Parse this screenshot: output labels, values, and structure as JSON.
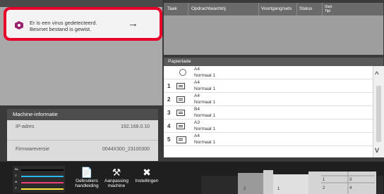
{
  "notification": {
    "line1": "Er is een virus gedetecteerd.",
    "line2": "Besmet bestand is gewist.",
    "arrow": "→",
    "icon": "virus-warning-icon",
    "accent_color": "#e8002a"
  },
  "machine_info": {
    "title": "Machine-informatie",
    "rows": [
      {
        "label": "IP-adres",
        "value": "192.168.0.10"
      },
      {
        "label": "Firmwareversie",
        "value": "0044X300_23100300"
      }
    ]
  },
  "job_queue": {
    "columns": [
      "Taak",
      "Opdrachtwachtrij",
      "Voortgang/sets",
      "Status",
      "Start Tijd"
    ]
  },
  "paper_trays": {
    "title": "Papierlade",
    "rows": [
      {
        "num": "",
        "size": "A4",
        "type": "Normaal 1",
        "icon": "bypass-tray-icon"
      },
      {
        "num": "1",
        "size": "A4",
        "type": "Normaal 1",
        "icon": "paper-tray-icon"
      },
      {
        "num": "2",
        "size": "A4",
        "type": "Normaal 1",
        "icon": "paper-tray-icon"
      },
      {
        "num": "3",
        "size": "B4",
        "type": "Normaal 1",
        "icon": "paper-tray-icon"
      },
      {
        "num": "4",
        "size": "A3",
        "type": "Normaal 1",
        "icon": "paper-tray-icon"
      },
      {
        "num": "5",
        "size": "A4",
        "type": "Normaal 1",
        "icon": "large-tray-icon"
      }
    ],
    "scroll": {
      "up": "^",
      "down": "v"
    }
  },
  "toner": {
    "labels": [
      "Bk",
      "C",
      "M",
      "Y"
    ],
    "colors": [
      "#000000",
      "#29b6f6",
      "#ec407a",
      "#ffeb3b"
    ]
  },
  "bottom_nav": [
    {
      "label_line1": "Gebruikers",
      "label_line2": "handleiding",
      "icon": "manual-icon"
    },
    {
      "label_line1": "Aanpassing",
      "label_line2": "machine",
      "icon": "adjust-icon"
    },
    {
      "label_line1": "Instellingen",
      "label_line2": "",
      "icon": "settings-icon"
    }
  ]
}
